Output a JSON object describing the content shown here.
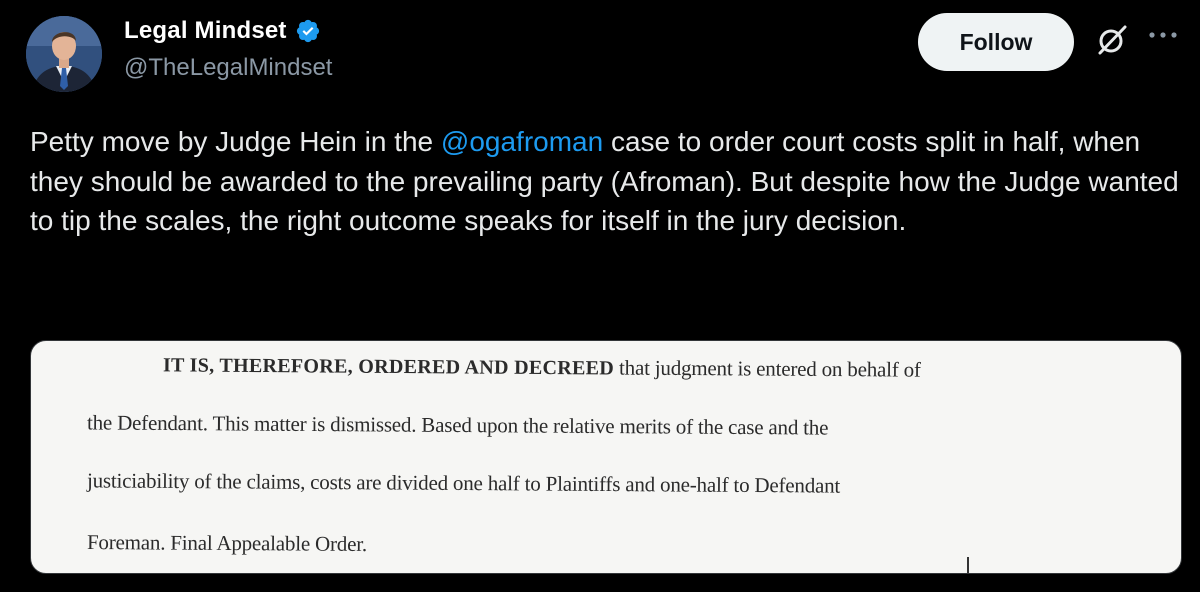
{
  "author": {
    "display_name": "Legal Mindset",
    "handle": "@TheLegalMindset",
    "verified": true,
    "avatar_icon": "profile-photo"
  },
  "actions": {
    "follow_label": "Follow",
    "grok_icon": "slashed-circle-icon",
    "more_icon": "more-horizontal-icon"
  },
  "post": {
    "text_before_mention": "Petty move by Judge Hein in the ",
    "mention": "@ogafroman",
    "text_after_mention": " case to order court costs split in half, when they should be awarded to the prevailing party (Afroman).  But despite how the Judge wanted to tip the scales, the right outcome speaks for itself in the jury decision."
  },
  "media": {
    "line1_bold": "IT IS, THEREFORE, ORDERED AND DECREED",
    "line1_rest": " that judgment is entered on behalf of",
    "line2": "the Defendant.   This matter is dismissed.   Based upon the relative merits of the case and the",
    "line3": "justiciability of the claims, costs are divided one half to Plaintiffs and one-half to Defendant",
    "line4": "Foreman.   Final Appealable Order."
  },
  "colors": {
    "background": "#000000",
    "text": "#e7e9ea",
    "secondary_text": "#8b98a5",
    "link": "#1d9bf0",
    "verified_badge": "#1d9bf0",
    "follow_button_bg": "#eff3f4"
  }
}
